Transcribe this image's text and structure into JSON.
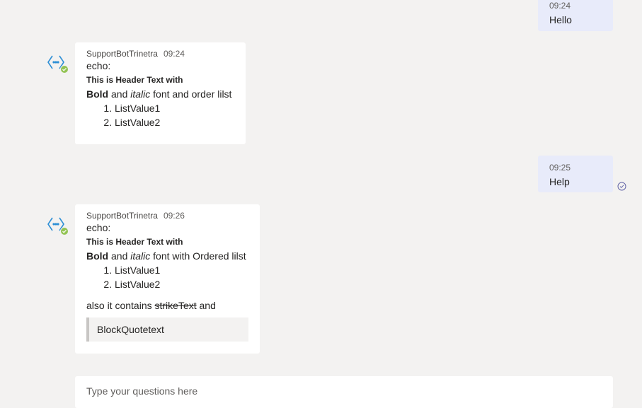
{
  "messages": {
    "user1": {
      "time": "09:24",
      "text": "Hello"
    },
    "bot1": {
      "sender": "SupportBotTrinetra",
      "time": "09:24",
      "echo": "echo:",
      "header": "This is Header Text with",
      "bold": "Bold",
      "and": "and",
      "italic": "italic",
      "rest": "font and order lilst",
      "list": [
        "ListValue1",
        "ListValue2"
      ]
    },
    "user2": {
      "time": "09:25",
      "text": "Help"
    },
    "bot2": {
      "sender": "SupportBotTrinetra",
      "time": "09:26",
      "echo": "echo:",
      "header": "This is Header Text with",
      "bold": "Bold",
      "and": "and",
      "italic": "italic",
      "rest": "font with Ordered lilst",
      "list": [
        "ListValue1",
        "ListValue2"
      ],
      "also": "also it contains",
      "strike": "strikeText",
      "and_end": "and",
      "blockquote": "BlockQuotetext"
    }
  },
  "compose": {
    "placeholder": "Type your questions here"
  },
  "icons": {
    "bot_avatar": "bot-avatar-icon",
    "online": "online-status-icon",
    "seen": "read-receipt-icon"
  },
  "colors": {
    "background": "#f3f2f1",
    "user_bubble": "#e8ebfa",
    "bot_bubble": "#ffffff",
    "avatar_blue": "#2d8fd5",
    "presence_green": "#92c353",
    "receipt": "#6264a7"
  }
}
